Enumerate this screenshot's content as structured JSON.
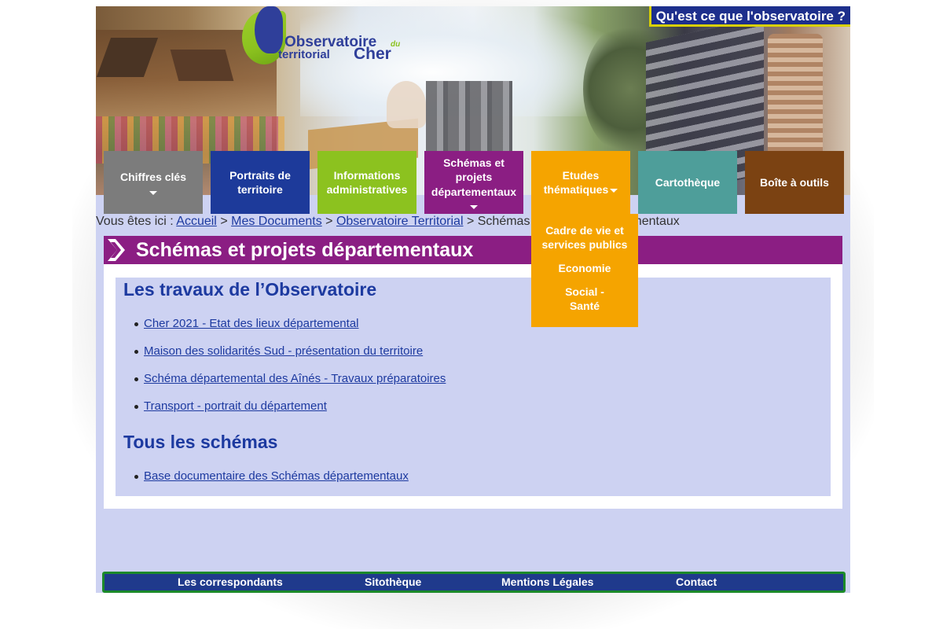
{
  "header": {
    "logo_line1": "Observatoire",
    "logo_line2": "territorial",
    "logo_du": "du",
    "logo_line3": "Cher",
    "top_button": "Qu'est ce que l'observatoire ?"
  },
  "nav": {
    "items": [
      {
        "label": "Chiffres clés",
        "color": "#7c7c7c",
        "dropdown": true
      },
      {
        "label": "Portraits de territoire",
        "color": "#1d3a9a",
        "dropdown": false
      },
      {
        "label": "Informations administratives",
        "color": "#8cc21f",
        "dropdown": false
      },
      {
        "label": "Schémas et projets départementaux",
        "color": "#8b1e83",
        "dropdown": true
      },
      {
        "label": "Etudes thématiques",
        "color": "#f5a400",
        "dropdown": true
      },
      {
        "label": "Cartothèque",
        "color": "#4e9e9a",
        "dropdown": false
      },
      {
        "label": "Boîte à outils",
        "color": "#7b4212",
        "dropdown": false
      }
    ],
    "submenu": {
      "items": [
        "Cadre de vie et services publics",
        "Economie",
        "Social - Santé"
      ]
    }
  },
  "breadcrumb": {
    "prefix": "Vous êtes ici :",
    "links": [
      "Accueil",
      "Mes Documents",
      "Observatoire Territorial"
    ],
    "current": "Schémas et projets départementaux",
    "separator": ">"
  },
  "page_title": "Schémas et projets départementaux",
  "sections": [
    {
      "heading": "Les travaux de l’Observatoire",
      "links": [
        "Cher 2021 - Etat des lieux départemental",
        "Maison des solidarités Sud - présentation du territoire",
        "Schéma départemental des Aînés - Travaux préparatoires",
        "Transport - portrait du département"
      ]
    },
    {
      "heading": "Tous les schémas",
      "links": [
        "Base documentaire des Schémas départementaux"
      ]
    }
  ],
  "footer": {
    "items": [
      "Les correspondants",
      "Sitothèque",
      "Mentions Légales",
      "Contact"
    ]
  },
  "colors": {
    "page_bg": "#cdd2f2",
    "title_bar": "#8b1e83",
    "link": "#1d3aa0",
    "footer_bg": "#1f3a8c",
    "footer_border": "#1c8a2a",
    "dropdown_bg": "#f5a400"
  }
}
